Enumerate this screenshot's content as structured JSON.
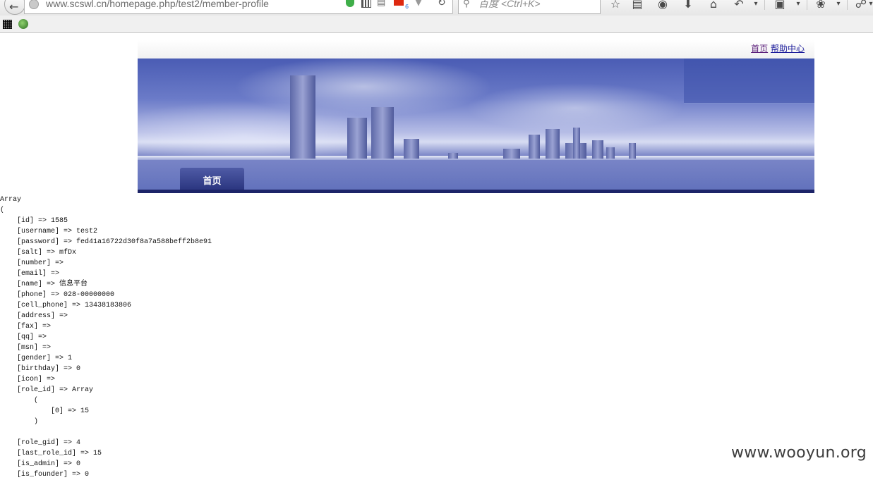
{
  "browser": {
    "url": "www.scswl.cn/homepage.php/test2/member-profile",
    "search_placeholder": "百度 <Ctrl+K>",
    "flag_count": "6",
    "icons": {
      "back": "back-arrow-icon",
      "site": "globe-icon",
      "shield": "shield-icon",
      "qr": "qr-code-icon",
      "reader": "reader-view-icon",
      "flag": "china-flag-icon",
      "dropdown": "dropdown-icon",
      "reload": "reload-icon",
      "search": "search-icon",
      "bookmark_star": "star-icon",
      "reading_list": "list-icon",
      "pocket": "pocket-icon",
      "download": "download-icon",
      "home": "home-icon",
      "undo": "undo-icon",
      "crop": "crop-icon",
      "extension": "extension-icon",
      "globe_menu": "globe-menu-icon"
    }
  },
  "bookmarks": {
    "icons": [
      "qr-grid-icon",
      "green-globe-icon"
    ]
  },
  "header": {
    "links": [
      {
        "label": "首页"
      },
      {
        "label": "帮助中心"
      }
    ],
    "nav_tab": "首页"
  },
  "dump": {
    "lines": [
      "Array",
      "(",
      "    [id] => 1585",
      "    [username] => test2",
      "    [password] => fed41a16722d30f8a7a588beff2b8e91",
      "    [salt] => mfDx",
      "    [number] =>",
      "    [email] =>",
      "    [name] => 信息平台",
      "    [phone] => 028-00000000",
      "    [cell_phone] => 13438183806",
      "    [address] =>",
      "    [fax] =>",
      "    [qq] =>",
      "    [msn] =>",
      "    [gender] => 1",
      "    [birthday] => 0",
      "    [icon] =>",
      "    [role_id] => Array",
      "        (",
      "            [0] => 15",
      "        )",
      "",
      "    [role_gid] => 4",
      "    [last_role_id] => 15",
      "    [is_admin] => 0",
      "    [is_founder] => 0"
    ]
  },
  "watermark": "www.wooyun.org",
  "colors": {
    "link": "#1a1a9a",
    "link_visited": "#5b1f7a",
    "banner_dark": "#1d2468",
    "tab_bg": "#2b3680"
  }
}
